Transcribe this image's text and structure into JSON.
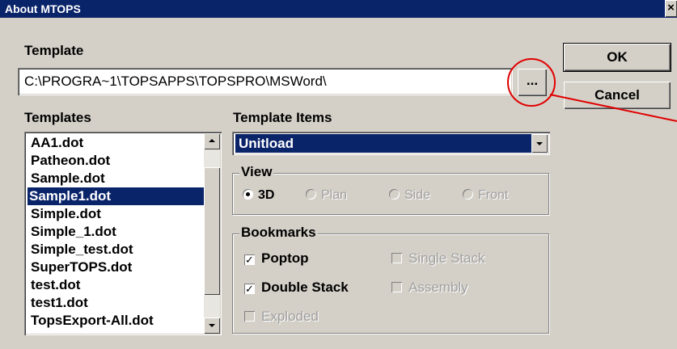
{
  "window": {
    "title": "About MTOPS",
    "close_glyph": "×"
  },
  "template_section": {
    "label": "Template",
    "path": "C:\\PROGRA~1\\TOPSAPPS\\TOPSPRO\\MSWord\\",
    "browse_label": "..."
  },
  "buttons": {
    "ok": "OK",
    "cancel": "Cancel"
  },
  "templates_list": {
    "label": "Templates",
    "items": [
      "AA1.dot",
      "Patheon.dot",
      "Sample.dot",
      "Sample1.dot",
      "Simple.dot",
      "Simple_1.dot",
      "Simple_test.dot",
      "SuperTOPS.dot",
      "test.dot",
      "test1.dot",
      "TopsExport-All.dot"
    ],
    "selected": "Sample1.dot"
  },
  "template_items": {
    "label": "Template Items",
    "value": "Unitload"
  },
  "view": {
    "label": "View",
    "options": [
      {
        "label": "3D",
        "selected": true,
        "enabled": true
      },
      {
        "label": "Plan",
        "selected": false,
        "enabled": false
      },
      {
        "label": "Side",
        "selected": false,
        "enabled": false
      },
      {
        "label": "Front",
        "selected": false,
        "enabled": false
      }
    ]
  },
  "bookmarks": {
    "label": "Bookmarks",
    "items": [
      {
        "label": "Poptop",
        "checked": true,
        "enabled": true
      },
      {
        "label": "Single Stack",
        "checked": false,
        "enabled": false
      },
      {
        "label": "Double Stack",
        "checked": true,
        "enabled": true
      },
      {
        "label": "Assembly",
        "checked": false,
        "enabled": false
      },
      {
        "label": "Exploded",
        "checked": false,
        "enabled": false
      }
    ]
  },
  "colors": {
    "title_bar": "#0a246a",
    "dialog_bg": "#d4d0c8",
    "selection": "#0a246a",
    "annotation": "#e00000"
  }
}
